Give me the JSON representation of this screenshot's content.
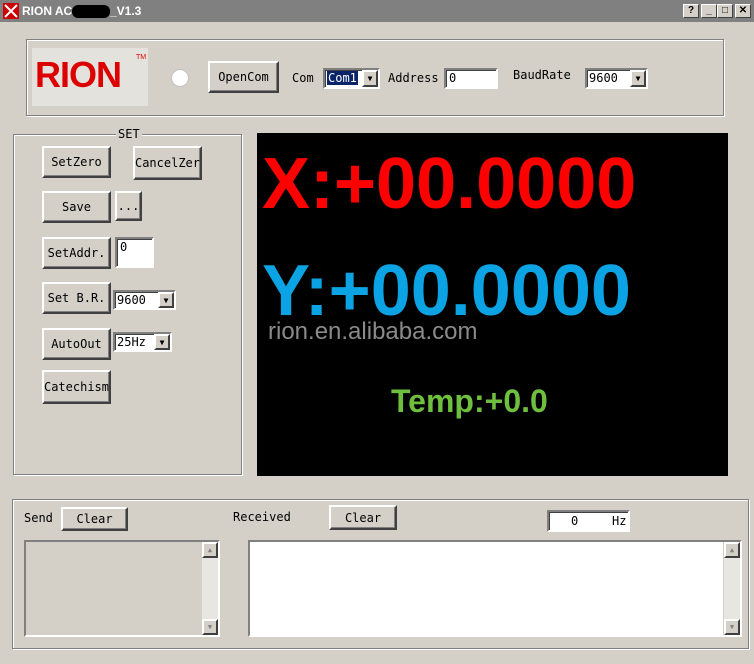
{
  "window": {
    "title_prefix": "RION ACA",
    "title_suffix": "_V1.3",
    "help_btn": "?",
    "min_btn": "_",
    "max_btn": "□",
    "close_btn": "✕"
  },
  "top": {
    "logo_text": "RION",
    "logo_tm": "TM",
    "open_com_label": "OpenCom",
    "com_label": "Com",
    "com_value": "Com1",
    "address_label": "Address",
    "address_value": "0",
    "baud_label": "BaudRate",
    "baud_value": "9600"
  },
  "set": {
    "group_label": "SET",
    "set_zero": "SetZero",
    "cancel_zero": "CancelZer",
    "save": "Save",
    "browse": "...",
    "set_addr": "SetAddr.",
    "addr_value": "0",
    "set_br": "Set B.R.",
    "br_value": "9600",
    "auto_out": "AutoOut",
    "auto_value": "25Hz",
    "catechism": "Catechism"
  },
  "display": {
    "x_text": "X:+00.0000",
    "y_text": "Y:+00.0000",
    "watermark": "rion.en.alibaba.com",
    "temp_text": "Temp:+0.0",
    "x_color": "#ff0000",
    "y_color": "#0ba3e3",
    "temp_color": "#6fbf3f"
  },
  "comm": {
    "send_label": "Send",
    "send_clear": "Clear",
    "received_label": "Received",
    "received_clear": "Clear",
    "hz_value": "0",
    "hz_unit": "Hz"
  }
}
